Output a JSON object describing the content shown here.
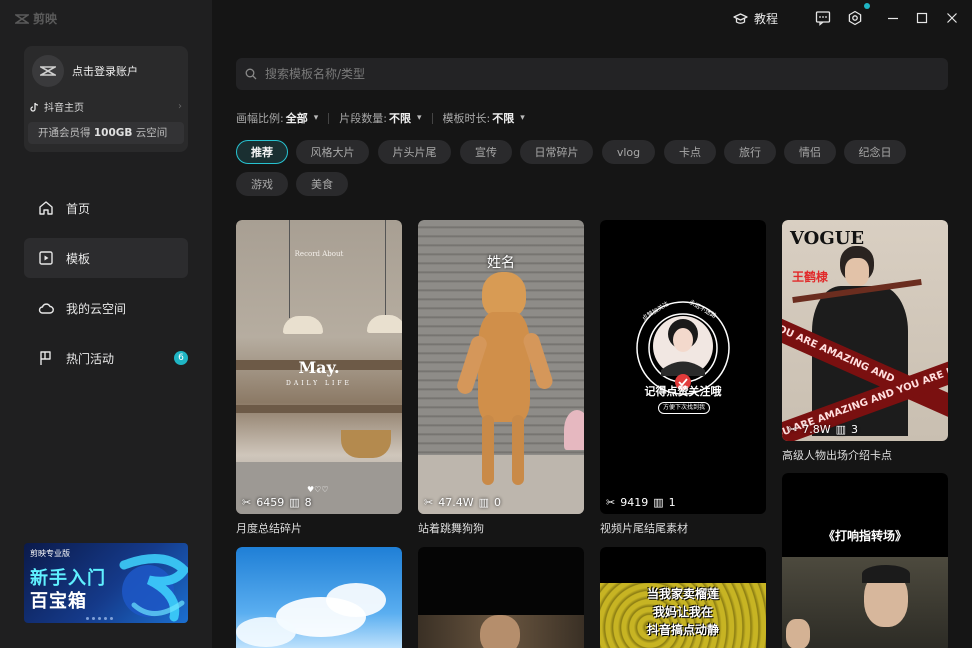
{
  "app": {
    "logo_text": "剪映"
  },
  "account": {
    "login_label": "点击登录账户",
    "douyin_label": "抖音主页",
    "vip_prefix": "开通会员得 ",
    "vip_highlight": "100GB",
    "vip_suffix": " 云空间"
  },
  "nav": {
    "items": [
      {
        "label": "首页",
        "icon": "home-icon"
      },
      {
        "label": "模板",
        "icon": "template-icon"
      },
      {
        "label": "我的云空间",
        "icon": "cloud-icon"
      },
      {
        "label": "热门活动",
        "icon": "flag-icon",
        "badge": "6"
      }
    ]
  },
  "promo": {
    "logo": "剪映专业版",
    "line1": "新手入门",
    "line2": "百宝箱"
  },
  "titlebar": {
    "tutorial_label": "教程"
  },
  "search": {
    "placeholder": "搜索模板名称/类型"
  },
  "filters": [
    {
      "label": "画幅比例:",
      "value": "全部"
    },
    {
      "label": "片段数量:",
      "value": "不限"
    },
    {
      "label": "模板时长:",
      "value": "不限"
    }
  ],
  "chips": [
    "推荐",
    "风格大片",
    "片头片尾",
    "宣传",
    "日常碎片",
    "vlog",
    "卡点",
    "旅行",
    "情侣",
    "纪念日",
    "游戏",
    "美食"
  ],
  "cards": [
    {
      "title": "月度总结碎片",
      "uses": "6459",
      "clips": "8",
      "overlay1": "Record About",
      "overlay2": "May.",
      "overlay3": "DAILY LIFE"
    },
    {
      "title": "站着跳舞狗狗",
      "uses": "47.4W",
      "clips": "0",
      "overlay1": "姓名"
    },
    {
      "title": "视频片尾结尾素材",
      "uses": "9419",
      "clips": "1",
      "overlay1": "记得点赞关注哦",
      "overlay2": "方便下次找到我",
      "ring_left": "点赞加关注",
      "ring_right": "永远不迷路"
    },
    {
      "title": "高级人物出场介绍卡点",
      "uses": "7.8W",
      "clips": "3",
      "overlay1": "VOGUE",
      "overlay2": "王鹤棣",
      "ribbon1": "YOU ARE AMAZING AND",
      "ribbon2": "YOU ARE AMAZING AND YOU ARE HA"
    },
    {
      "overlay1": "《打响指转场》"
    },
    {},
    {},
    {
      "overlay1": "当我家卖榴莲",
      "overlay2": "我妈让我在",
      "overlay3": "抖音搞点动静"
    }
  ]
}
